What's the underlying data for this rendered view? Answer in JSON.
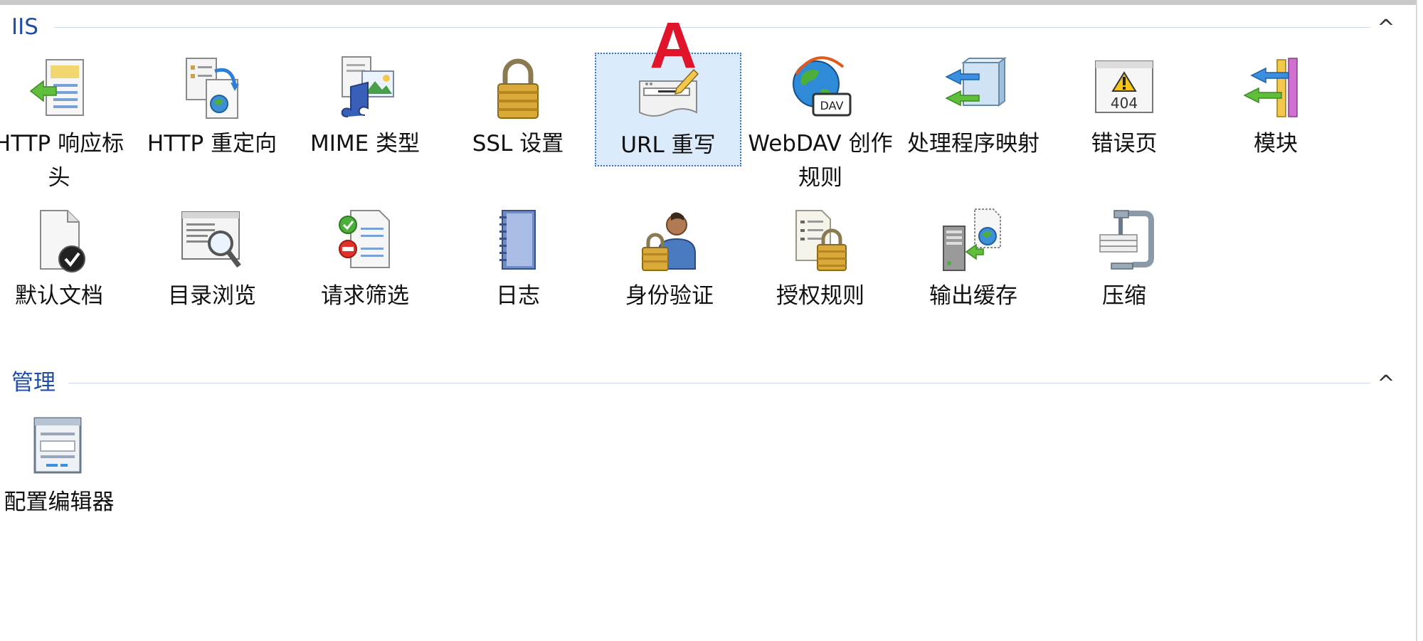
{
  "groups": {
    "iis": {
      "title": "IIS",
      "collapse_glyph": "^"
    },
    "manage": {
      "title": "管理",
      "collapse_glyph": "^"
    }
  },
  "annotation": {
    "label": "A",
    "color": "#e0142a"
  },
  "tiles": [
    {
      "label": "HTTP 响应标头",
      "icon": "http-response-headers-icon"
    },
    {
      "label": "HTTP 重定向",
      "icon": "http-redirect-icon"
    },
    {
      "label": "MIME 类型",
      "icon": "mime-types-icon"
    },
    {
      "label": "SSL 设置",
      "icon": "ssl-lock-icon"
    },
    {
      "label": "URL 重写",
      "icon": "url-rewrite-icon",
      "selected": true
    },
    {
      "label": "WebDAV 创作规则",
      "icon": "webdav-globe-icon"
    },
    {
      "label": "处理程序映射",
      "icon": "handler-mappings-icon"
    },
    {
      "label": "错误页",
      "icon": "error-page-404-icon"
    },
    {
      "label": "模块",
      "icon": "modules-icon"
    },
    {
      "label": "默认文档",
      "icon": "default-document-icon"
    },
    {
      "label": "目录浏览",
      "icon": "directory-browsing-icon"
    },
    {
      "label": "请求筛选",
      "icon": "request-filtering-icon"
    },
    {
      "label": "日志",
      "icon": "logging-notebook-icon"
    },
    {
      "label": "身份验证",
      "icon": "authentication-user-lock-icon"
    },
    {
      "label": "授权规则",
      "icon": "authorization-rules-icon"
    },
    {
      "label": "输出缓存",
      "icon": "output-caching-icon"
    },
    {
      "label": "压缩",
      "icon": "compression-clamp-icon"
    },
    {
      "label": "配置编辑器",
      "icon": "configuration-editor-icon"
    }
  ]
}
